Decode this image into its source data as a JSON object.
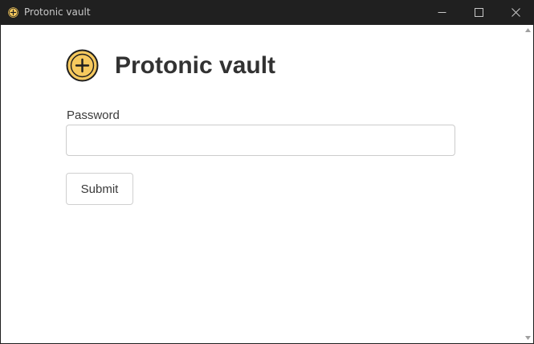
{
  "window": {
    "title": "Protonic vault",
    "icon": "plus-coin-icon",
    "controls": {
      "minimize": "minimize-icon",
      "maximize": "maximize-icon",
      "close": "close-icon"
    }
  },
  "page": {
    "logo_icon": "plus-coin-icon",
    "title": "Protonic vault"
  },
  "form": {
    "password_label": "Password",
    "password_value": "",
    "password_placeholder": "",
    "submit_label": "Submit"
  },
  "colors": {
    "titlebar_bg": "#202020",
    "logo_fill": "#f6c95e",
    "logo_stroke": "#1e1e1e",
    "content_bg": "#ffffff"
  }
}
